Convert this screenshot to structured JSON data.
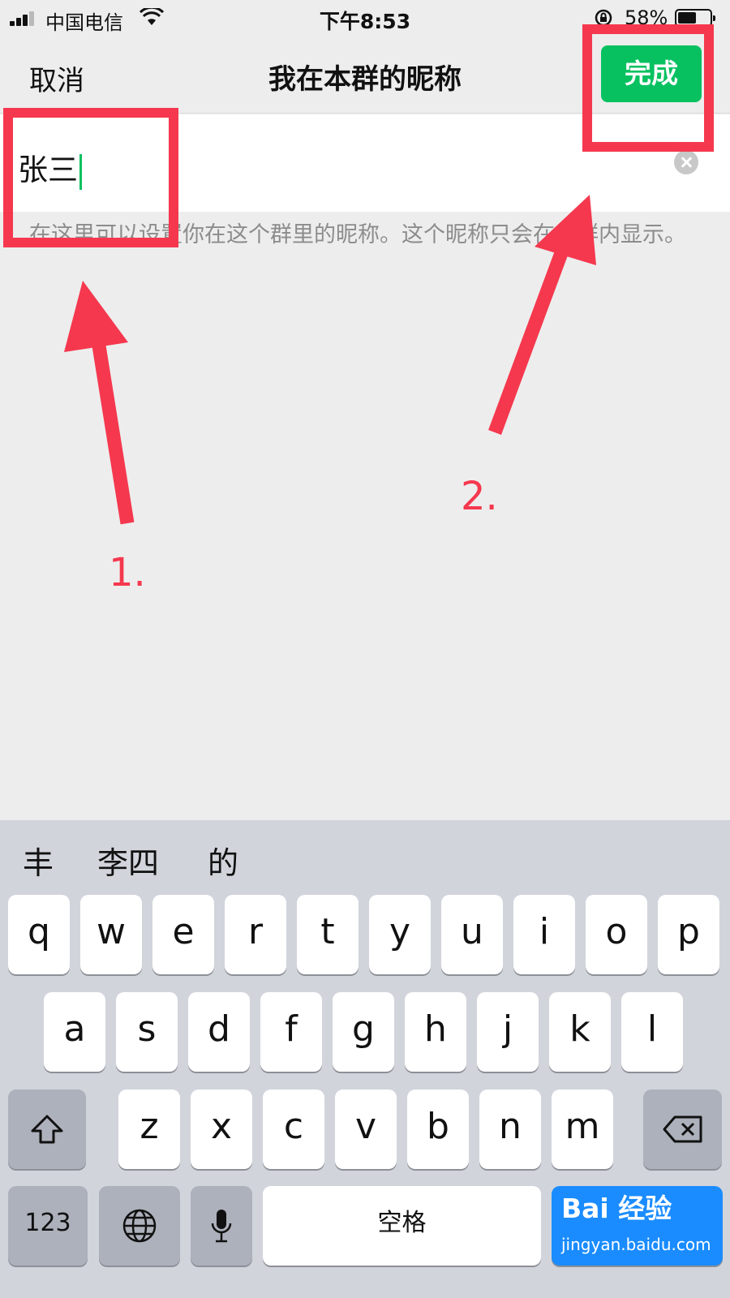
{
  "status_bar": {
    "carrier": "中国电信",
    "time": "下午8:53",
    "battery_percent": "58%",
    "battery_level": 0.58,
    "icons": [
      "signal-icon",
      "wifi-icon",
      "orientation-lock-icon",
      "battery-icon"
    ]
  },
  "nav": {
    "cancel": "取消",
    "title": "我在本群的昵称",
    "done": "完成",
    "done_color": "#07c160"
  },
  "input": {
    "value": "张三",
    "caret_color": "#07c160",
    "clear_icon": "clear-icon"
  },
  "hint": "在这里可以设置你在这个群里的昵称。这个昵称只会在此群内显示。",
  "annotations": {
    "color": "#f5384e",
    "labels": [
      "1.",
      "2."
    ]
  },
  "keyboard": {
    "candidates": [
      "丰",
      "李四",
      "的"
    ],
    "row1": [
      "q",
      "w",
      "e",
      "r",
      "t",
      "y",
      "u",
      "i",
      "o",
      "p"
    ],
    "row2": [
      "a",
      "s",
      "d",
      "f",
      "g",
      "h",
      "j",
      "k",
      "l"
    ],
    "row3": [
      "z",
      "x",
      "c",
      "v",
      "b",
      "n",
      "m"
    ],
    "numbers": "123",
    "space": "空格",
    "icons": [
      "shift-icon",
      "backspace-icon",
      "globe-icon",
      "microphone-icon"
    ],
    "go_color": "#1a8cff"
  },
  "watermark": {
    "main": "Bai 经验",
    "sub": "jingyan.baidu.com"
  }
}
